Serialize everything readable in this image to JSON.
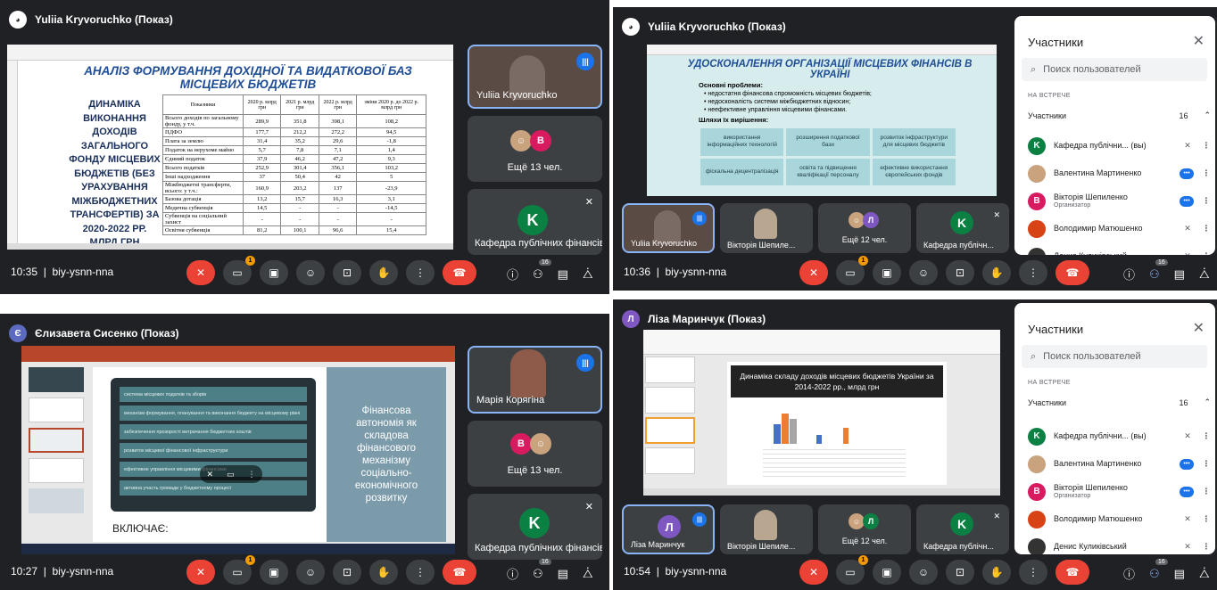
{
  "q1": {
    "presenter": "Yuliia Kryvoruchko (Показ)",
    "slide_title": "АНАЛІЗ ФОРМУВАННЯ ДОХІДНОЇ ТА ВИДАТКОВОЇ БАЗ МІСЦЕВИХ БЮДЖЕТІВ",
    "slide_side": "ДИНАМІКА ВИКОНАННЯ ДОХОДІВ ЗАГАЛЬНОГО ФОНДУ МІСЦЕВИХ БЮДЖЕТІВ (БЕЗ УРАХУВАННЯ МІЖБЮДЖЕТНИХ ТРАНСФЕРТІВ) ЗА 2020-2022 РР. МЛРД ГРН",
    "table_headers": [
      "Показники",
      "2020 р. млрд грн",
      "2021 р. млрд грн",
      "2022 р. млрд грн",
      "зміни 2020 р. до 2022 р. млрд грн"
    ],
    "table_rows": [
      [
        "Всього доходів по загальному фонду, у т.ч.",
        "289,9",
        "351,8",
        "398,1",
        "108,2"
      ],
      [
        "ПДФО",
        "177,7",
        "212,2",
        "272,2",
        "94,5"
      ],
      [
        "Плата за землю",
        "31,4",
        "35,2",
        "29,6",
        "-1,8"
      ],
      [
        "Податок на нерухоме майно",
        "5,7",
        "7,8",
        "7,1",
        "1,4"
      ],
      [
        "Єдиний податок",
        "37,9",
        "46,2",
        "47,2",
        "9,3"
      ],
      [
        "Всього податків",
        "252,9",
        "301,4",
        "356,1",
        "103,2"
      ],
      [
        "Інші надходження",
        "37",
        "50,4",
        "42",
        "5"
      ],
      [
        "Міжбюджетні трансферти, всього: у т.ч.:",
        "160,9",
        "203,2",
        "137",
        "-23,9"
      ],
      [
        "Базова дотація",
        "13,2",
        "15,7",
        "16,3",
        "3,1"
      ],
      [
        "Медична субвенція",
        "14,5",
        "-",
        "-",
        "-14,5"
      ],
      [
        "Субвенція на соціальний захист",
        "-",
        "-",
        "-",
        "-"
      ],
      [
        "Освітня субвенція",
        "81,2",
        "100,1",
        "96,6",
        "15,4"
      ]
    ],
    "tile_self": "Yuliia Kryvoruchko",
    "tile_more": "Ещё 13 чел.",
    "tile_dept": "Кафедра публічних фінансів",
    "avatar_v": "В",
    "avatar_k": "K",
    "time": "10:35",
    "code": "biy-ysnn-nna",
    "count": "16",
    "badge": "1"
  },
  "q2": {
    "presenter": "Yuliia Kryvoruchko (Показ)",
    "slide_title": "УДОСКОНАЛЕННЯ ОРГАНІЗАЦІЇ МІСЦЕВИХ ФІНАНСІВ В УКРАЇНІ",
    "problems_head": "Основні проблеми:",
    "problems": [
      "недостатня фінансова спроможність місцевих бюджетів;",
      "недосконалість системи міжбюджетних відносин;",
      "неефективне управління місцевими фінансами."
    ],
    "ways_head": "Шляхи їх вирішення:",
    "boxes": [
      "використання інформаційних технологій",
      "розширення податкової бази",
      "розвиток інфраструктури для місцевих бюджетів",
      "фіскальна децентралізація",
      "освіта та підвищення кваліфікації персоналу",
      "ефективне використання європейських фондів"
    ],
    "tiles": [
      "Yuliia Kryvoruchko",
      "Вікторія Шепиле...",
      "Ещё 12 чел.",
      "Кафедра публічн..."
    ],
    "avatar_l": "Л",
    "time": "10:36",
    "code": "biy-ysnn-nna",
    "count": "16",
    "badge": "1"
  },
  "q3": {
    "presenter": "Єлизавета Сисенко (Показ)",
    "avatar_e": "Є",
    "items": [
      "система місцевих податків та зборів",
      "механізм формування, планування та виконання бюджету на місцевому рівні",
      "забезпечення прозорості витрачання бюджетних коштів",
      "розвиток місцевої фінансової інфраструктури",
      "ефективне управління місцевими фінансами",
      "активна участь громади у бюджетному процесі"
    ],
    "bottom_label": "ВКЛЮЧАЄ:",
    "side_text": "Фінансова автономія як складова фінансового механізму соціально-економічного розвитку",
    "tiles": [
      "Марія Корягіна",
      "Ещё 13 чел.",
      "Кафедра публічних фінансів"
    ],
    "time": "10:27",
    "code": "biy-ysnn-nna",
    "count": "16",
    "badge": "1"
  },
  "q4": {
    "presenter": "Ліза Маринчук (Показ)",
    "slide_title": "Динаміка складу доходів місцевих бюджетів України за 2014-2022 рр., млрд грн",
    "tiles": [
      "Ліза Маринчук",
      "Вікторія Шепиле...",
      "Ещё 12 чел.",
      "Кафедра публічн..."
    ],
    "time": "10:54",
    "code": "biy-ysnn-nna",
    "count": "16",
    "badge": "1"
  },
  "panel": {
    "title": "Участники",
    "search_placeholder": "Поиск пользователей",
    "meeting_label": "НА ВСТРЕЧЕ",
    "group_label": "Участники",
    "group_count": "16",
    "people": [
      {
        "initial": "K",
        "name": "Кафедра публічни... (вы)",
        "sub": ""
      },
      {
        "initial": "",
        "name": "Валентина Мартиненко",
        "sub": ""
      },
      {
        "initial": "В",
        "name": "Вікторія Шепиленко",
        "sub": "Организатор"
      },
      {
        "initial": "",
        "name": "Володимир Матюшенко",
        "sub": ""
      },
      {
        "initial": "",
        "name": "Денис Куликівський",
        "sub": ""
      }
    ]
  },
  "colors": {
    "meet_dark": "#202124",
    "tile": "#3c4043",
    "red": "#ea4335",
    "blue": "#1a73e8",
    "teal": "#0b8043",
    "pink": "#d81b60",
    "purple": "#7e57c2"
  }
}
